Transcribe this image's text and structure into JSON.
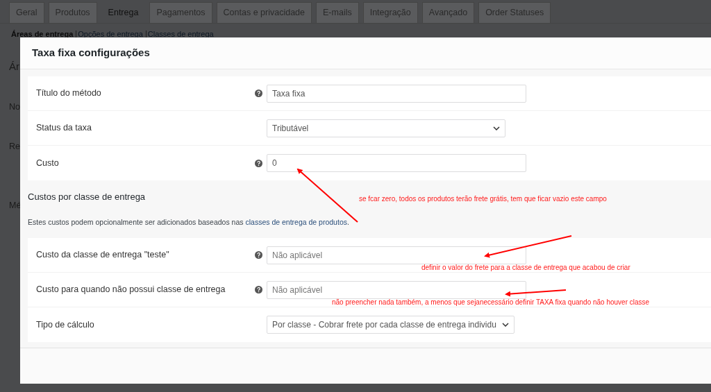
{
  "background_page": {
    "tabs": [
      {
        "label": "Geral",
        "selected": false
      },
      {
        "label": "Produtos",
        "selected": false
      },
      {
        "label": "Entrega",
        "selected": true
      },
      {
        "label": "Pagamentos",
        "selected": false
      },
      {
        "label": "Contas e privacidade",
        "selected": false
      },
      {
        "label": "E-mails",
        "selected": false
      },
      {
        "label": "Integração",
        "selected": false
      },
      {
        "label": "Avançado",
        "selected": false
      },
      {
        "label": "Order Statuses",
        "selected": false
      }
    ],
    "sub_nav": [
      {
        "label": "Áreas de entrega",
        "selected": true
      },
      {
        "label": "Opções de entrega",
        "selected": false
      },
      {
        "label": "Classes de entrega",
        "selected": false
      }
    ],
    "cut_labels": [
      "Ár",
      "No",
      "Re",
      "Mé"
    ]
  },
  "modal": {
    "title": "Taxa fixa configurações",
    "general_rows": [
      {
        "label": "Título do método",
        "help": true,
        "kind": "text",
        "value": "Taxa fixa"
      },
      {
        "label": "Status da taxa",
        "help": false,
        "kind": "select",
        "value": "Tributável"
      },
      {
        "label": "Custo",
        "help": true,
        "kind": "text",
        "value": "0"
      }
    ],
    "class_section": {
      "heading": "Custos por classe de entrega",
      "description": "Estes custos podem opcionalmente ser adicionados baseados nas",
      "link": "classes de entrega de produtos",
      "after_link": "."
    },
    "class_rows": [
      {
        "label": "Custo da classe de entrega \"teste\"",
        "help": true,
        "kind": "text",
        "placeholder": "Não aplicável"
      },
      {
        "label": "Custo para quando não possui classe de entrega",
        "help": true,
        "kind": "text",
        "placeholder": "Não aplicável"
      },
      {
        "label": "Tipo de cálculo",
        "help": false,
        "kind": "select",
        "value": "Por classe - Cobrar frete por cada classe de entrega individu"
      }
    ]
  },
  "annotations": [
    "se fcar zero, todos os produtos terão frete grátis, tem que ficar vazio este campo",
    "definir o valor do frete para a classe de entrega que acabou de criar",
    "não preencher nada também, a menos que sejanecessário definir TAXA fixa quando não houver classe"
  ]
}
